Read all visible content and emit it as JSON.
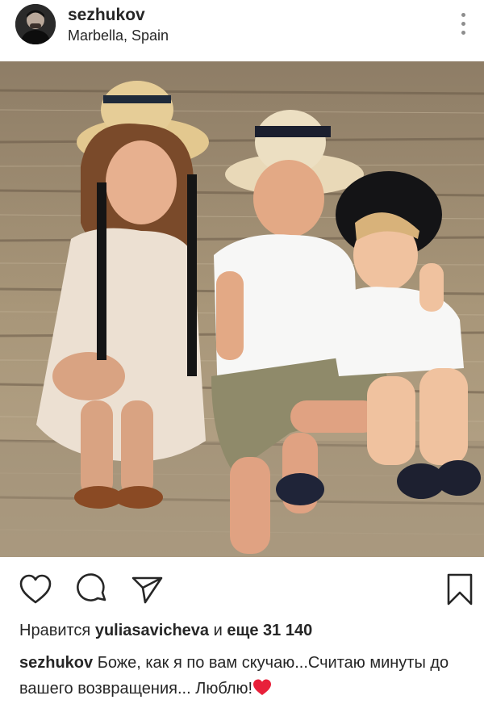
{
  "post": {
    "username": "sezhukov",
    "location": "Marbella, Spain",
    "likes_prefix": "Нравится",
    "liked_by": "yuliasavicheva",
    "likes_conj": "и",
    "likes_others": "еще 31 140",
    "caption_user": "sezhukov",
    "caption_text": "Боже, как я по вам скучаю...Считаю минуты до вашего возвращения... Люблю!"
  },
  "icons": {
    "more": "more-vertical-icon",
    "like": "heart-outline-icon",
    "comment": "comment-bubble-icon",
    "share": "paper-plane-icon",
    "save": "bookmark-icon",
    "emoji": "red-heart-emoji"
  },
  "colors": {
    "text": "#262626",
    "secondary": "#8e8e8e",
    "emoji_heart": "#e8203a"
  }
}
